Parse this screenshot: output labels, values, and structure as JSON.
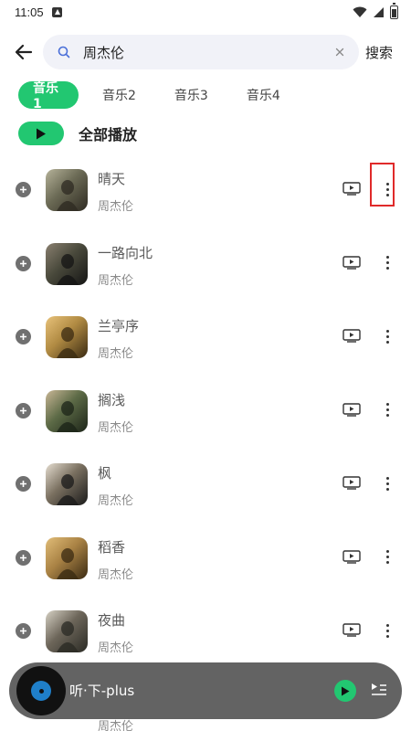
{
  "status_bar": {
    "time": "11:05"
  },
  "search": {
    "query": "周杰伦",
    "submit_label": "搜索"
  },
  "tabs": [
    {
      "label": "音乐1",
      "active": true
    },
    {
      "label": "音乐2",
      "active": false
    },
    {
      "label": "音乐3",
      "active": false
    },
    {
      "label": "音乐4",
      "active": false
    }
  ],
  "play_all": {
    "label": "全部播放"
  },
  "songs": [
    {
      "title": "晴天",
      "artist": "周杰伦"
    },
    {
      "title": "一路向北",
      "artist": "周杰伦"
    },
    {
      "title": "兰亭序",
      "artist": "周杰伦"
    },
    {
      "title": "搁浅",
      "artist": "周杰伦"
    },
    {
      "title": "枫",
      "artist": "周杰伦"
    },
    {
      "title": "稻香",
      "artist": "周杰伦"
    },
    {
      "title": "夜曲",
      "artist": "周杰伦"
    }
  ],
  "peek_row": {
    "artist": "周杰伦"
  },
  "mini_player": {
    "title": "听·下-plus"
  },
  "colors": {
    "accent": "#22c771",
    "highlight": "#e02a2a",
    "player_bg": "#636363"
  }
}
